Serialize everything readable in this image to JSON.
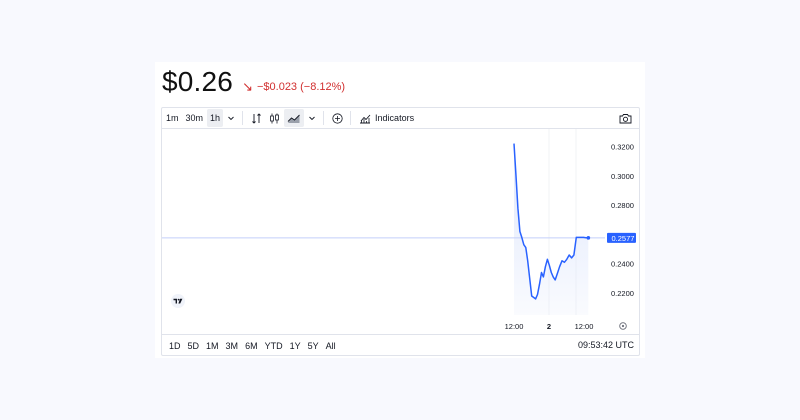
{
  "price": {
    "value": "$0.26",
    "change": "−$0.023 (−8.12%)",
    "arrow_icon": "arrow-down-right-icon",
    "change_color": "#d12f2f"
  },
  "toolbar": {
    "intervals": [
      "1m",
      "30m",
      "1h"
    ],
    "active_interval": "1h",
    "indicators_label": "Indicators"
  },
  "ranges": [
    "1D",
    "5D",
    "1M",
    "3M",
    "6M",
    "YTD",
    "1Y",
    "5Y",
    "All"
  ],
  "clock": "09:53:42 UTC",
  "colors": {
    "line": "#2962ff",
    "area_fill": "#dbe4fb",
    "price_label_bg": "#2962ff",
    "baseline": "#c3cffa"
  },
  "chart_data": {
    "type": "area",
    "y_tick_labels": [
      "0.3200",
      "0.3000",
      "0.2800",
      "0.2400",
      "0.2200"
    ],
    "ylim": [
      0.205,
      0.332
    ],
    "x_tick_labels": [
      "12:00",
      "2",
      "12:00"
    ],
    "current_price_label": "0.2577",
    "grid": false,
    "series": [
      {
        "x_hours": [
          0,
          0.9,
          1.8,
          2.7,
          3.6,
          4.5,
          5.4,
          6.3,
          7.2,
          8.1,
          9,
          9.9,
          10.8,
          11.7,
          12.6,
          13.5,
          14.4,
          15.3,
          16.2,
          17.1,
          18,
          18.9,
          19.8,
          20.9,
          22,
          23.1,
          24.2,
          25.3,
          26.4,
          27.5,
          28.6,
          29.7,
          30.8,
          31.9,
          33,
          34.1
        ],
        "values": [
          0.322,
          0.3,
          0.278,
          0.262,
          0.258,
          0.253,
          0.251,
          0.242,
          0.23,
          0.218,
          0.217,
          0.216,
          0.219,
          0.226,
          0.234,
          0.231,
          0.238,
          0.243,
          0.239,
          0.234,
          0.231,
          0.229,
          0.233,
          0.238,
          0.242,
          0.241,
          0.243,
          0.246,
          0.244,
          0.246,
          0.258,
          0.258,
          0.258,
          0.258,
          0.2577,
          0.2577
        ]
      }
    ]
  }
}
